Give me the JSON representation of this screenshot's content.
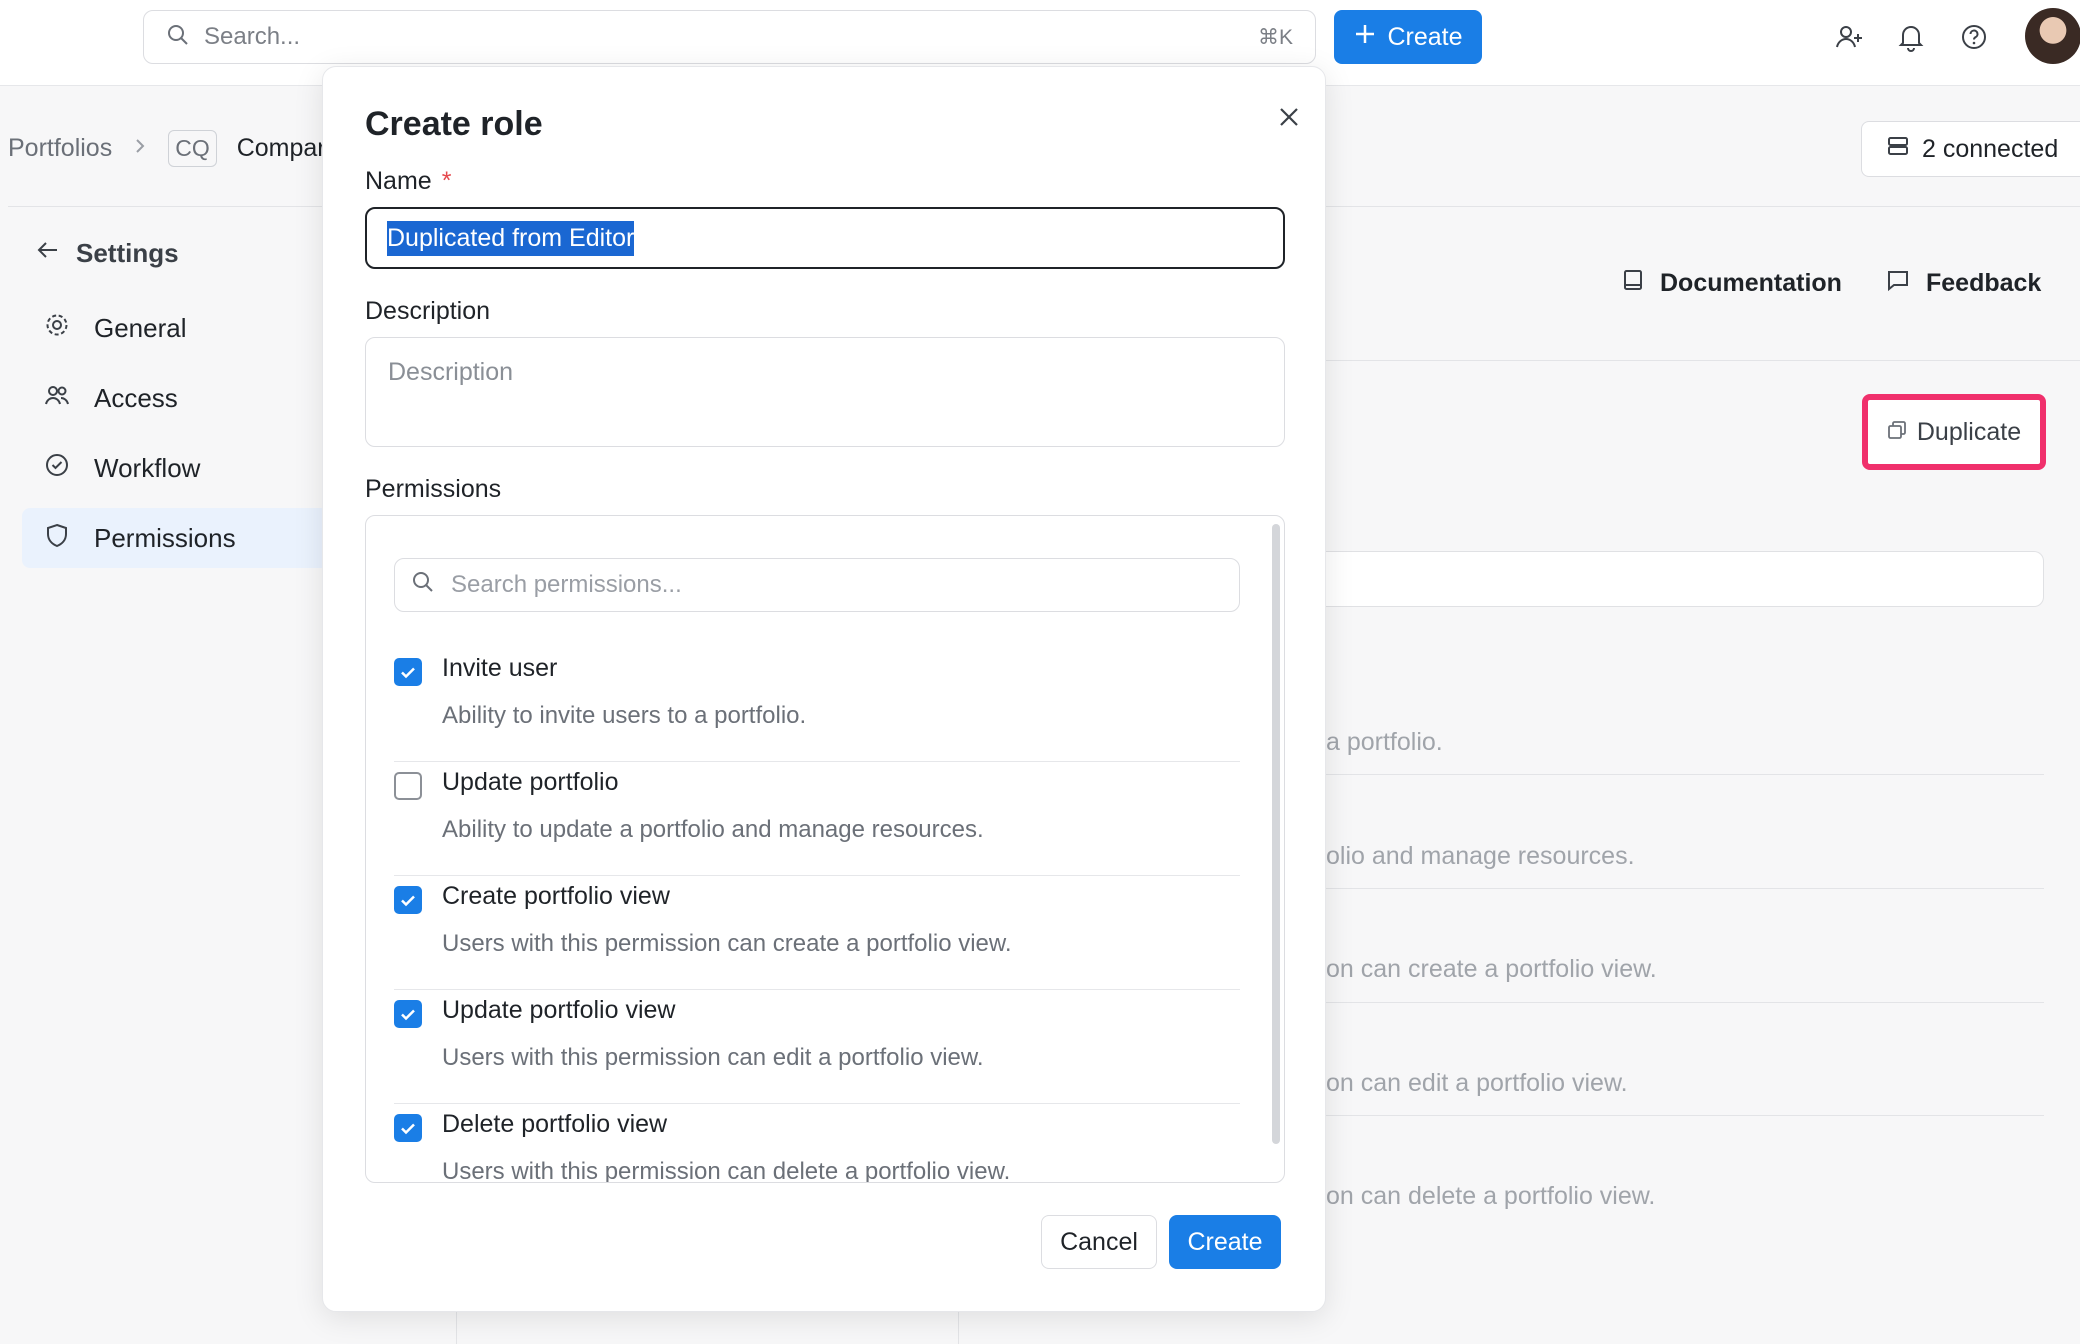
{
  "topbar": {
    "search_placeholder": "Search...",
    "search_shortcut": "⌘K",
    "create_label": "Create"
  },
  "breadcrumb": {
    "portfolios": "Portfolios",
    "badge": "CQ",
    "company": "Compar"
  },
  "connected_label": "2 connected",
  "sidebar": {
    "back_label": "Settings",
    "items": [
      {
        "label": "General",
        "icon": "gear-icon"
      },
      {
        "label": "Access",
        "icon": "users-icon"
      },
      {
        "label": "Workflow",
        "icon": "check-circle-icon"
      },
      {
        "label": "Permissions",
        "icon": "shield-icon"
      }
    ]
  },
  "header_links": {
    "documentation": "Documentation",
    "feedback": "Feedback"
  },
  "duplicate_label": "Duplicate",
  "background_rows": [
    "a portfolio.",
    "olio and manage resources.",
    "on can create a portfolio view.",
    "on can edit a portfolio view.",
    "on can delete a portfolio view."
  ],
  "modal": {
    "title": "Create role",
    "name_label": "Name",
    "required_mark": "*",
    "name_value": "Duplicated from Editor",
    "description_label": "Description",
    "description_placeholder": "Description",
    "permissions_label": "Permissions",
    "permissions_search_placeholder": "Search permissions...",
    "permissions": [
      {
        "name": "Invite user",
        "description": "Ability to invite users to a portfolio.",
        "checked": true
      },
      {
        "name": "Update portfolio",
        "description": "Ability to update a portfolio and manage resources.",
        "checked": false
      },
      {
        "name": "Create portfolio view",
        "description": "Users with this permission can create a portfolio view.",
        "checked": true
      },
      {
        "name": "Update portfolio view",
        "description": "Users with this permission can edit a portfolio view.",
        "checked": true
      },
      {
        "name": "Delete portfolio view",
        "description": "Users with this permission can delete a portfolio view.",
        "checked": true
      }
    ],
    "cancel_label": "Cancel",
    "create_label": "Create"
  },
  "colors": {
    "accent": "#1a7ee6",
    "highlight": "#f0306c",
    "selection": "#1a67d2"
  }
}
